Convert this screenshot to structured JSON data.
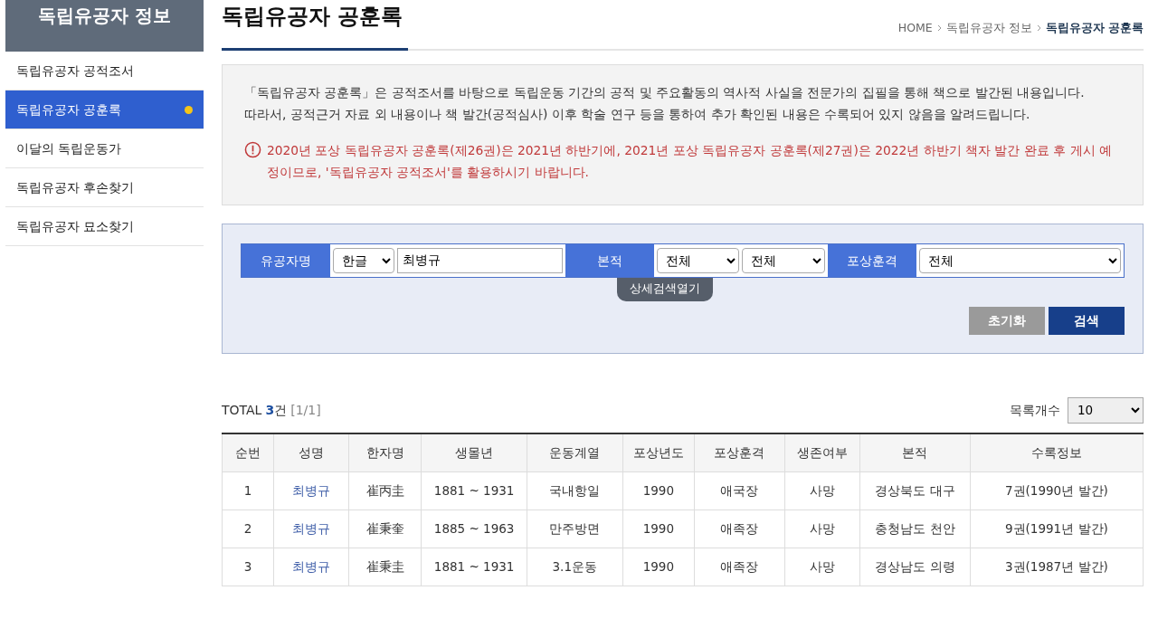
{
  "sidebar": {
    "title": "독립유공자 정보",
    "items": [
      {
        "label": "독립유공자 공적조서",
        "selected": false
      },
      {
        "label": "독립유공자 공훈록",
        "selected": true
      },
      {
        "label": "이달의 독립운동가",
        "selected": false
      },
      {
        "label": "독립유공자 후손찾기",
        "selected": false
      },
      {
        "label": "독립유공자 묘소찾기",
        "selected": false
      }
    ]
  },
  "page": {
    "title": "독립유공자 공훈록",
    "breadcrumb": [
      "HOME",
      "독립유공자 정보",
      "독립유공자 공훈록"
    ]
  },
  "notice": {
    "paragraphs": [
      "「독립유공자 공훈록」은 공적조서를 바탕으로 독립운동 기간의 공적 및 주요활동의 역사적 사실을 전문가의 집필을 통해 책으로 발간된 내용입니다.",
      "따라서, 공적근거 자료 외 내용이나 책 발간(공적심사) 이후 학술 연구 등을 통하여 추가 확인된 내용은 수록되어 있지 않음을 알려드립니다."
    ],
    "warning": "2020년 포상 독립유공자 공훈록(제26권)은 2021년 하반기에, 2021년 포상 독립유공자 공훈록(제27권)은 2022년 하반기 책자 발간 완료 후 게시 예정이므로, '독립유공자 공적조서'를 활용하시기 바랍니다."
  },
  "search": {
    "fields": [
      {
        "label": "유공자명",
        "controls": [
          {
            "kind": "select",
            "value": "한글"
          },
          {
            "kind": "input",
            "value": "최병규"
          }
        ]
      },
      {
        "label": "본적",
        "controls": [
          {
            "kind": "select",
            "value": "전체"
          },
          {
            "kind": "select",
            "value": "전체"
          }
        ]
      },
      {
        "label": "포상훈격",
        "controls": [
          {
            "kind": "select",
            "value": "전체"
          }
        ]
      }
    ],
    "toggle": "상세검색열기",
    "buttons": [
      {
        "label": "초기화",
        "kind": "reset"
      },
      {
        "label": "검색",
        "kind": "submit"
      }
    ]
  },
  "results": {
    "total_label": "TOTAL",
    "count": "3",
    "unit": "건",
    "page": "[1/1]",
    "page_size_label": "목록개수",
    "page_size": "10"
  },
  "table": {
    "columns": [
      "순번",
      "성명",
      "한자명",
      "생몰년",
      "운동계열",
      "포상년도",
      "포상훈격",
      "생존여부",
      "본적",
      "수록정보"
    ],
    "rows": [
      [
        "1",
        "최병규",
        "崔丙圭",
        "1881 ~ 1931",
        "국내항일",
        "1990",
        "애국장",
        "사망",
        "경상북도 대구",
        "7권(1990년 발간)"
      ],
      [
        "2",
        "최병규",
        "崔秉奎",
        "1885 ~ 1963",
        "만주방면",
        "1990",
        "애족장",
        "사망",
        "충청남도 천안",
        "9권(1991년 발간)"
      ],
      [
        "3",
        "최병규",
        "崔秉圭",
        "1881 ~ 1931",
        "3.1운동",
        "1990",
        "애족장",
        "사망",
        "경상남도 의령",
        "3권(1987년 발간)"
      ]
    ]
  }
}
